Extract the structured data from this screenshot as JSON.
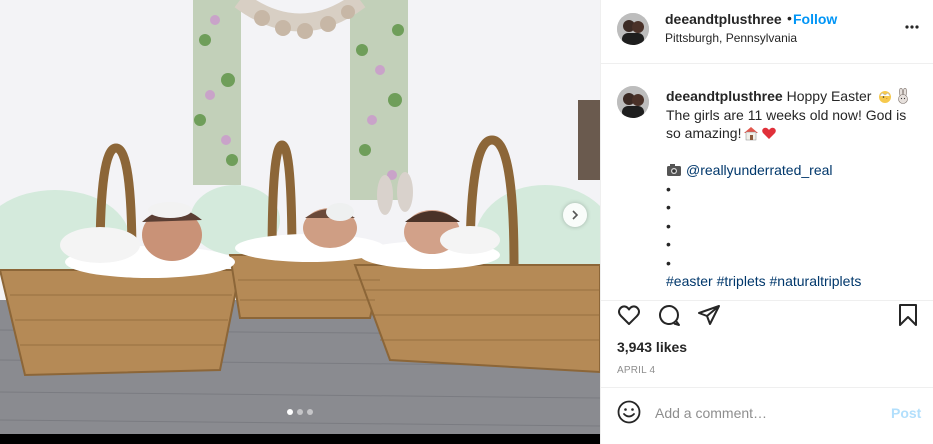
{
  "post": {
    "username": "deeandtplusthree",
    "follow_sep": "•",
    "follow_label": "Follow",
    "location": "Pittsburgh, Pennsylvania"
  },
  "caption": {
    "username": "deeandtplusthree",
    "line1": "Hoppy Easter",
    "line2": "The girls are 11 weeks old now! God is",
    "line3": "so amazing!",
    "camera_mention": "@reallyunderrated_real",
    "bullets": [
      "•",
      "•",
      "•",
      "•",
      "•"
    ],
    "hashtags": [
      "#easter",
      "#triplets",
      "#naturaltriplets"
    ],
    "emojis": [
      "chick-icon",
      "rabbit-icon",
      "house-icon",
      "heart-icon",
      "camera-icon"
    ]
  },
  "stats": {
    "likes": "3,943 likes",
    "date": "APRIL 4"
  },
  "comment": {
    "placeholder": "Add a comment…",
    "post_label": "Post"
  },
  "carousel": {
    "slides": 3,
    "active_index": 0
  },
  "colors": {
    "link_blue": "#0095f6",
    "mention": "#00376b",
    "post_disabled": "#b2dffc",
    "meta_gray": "#8e8e8e"
  }
}
